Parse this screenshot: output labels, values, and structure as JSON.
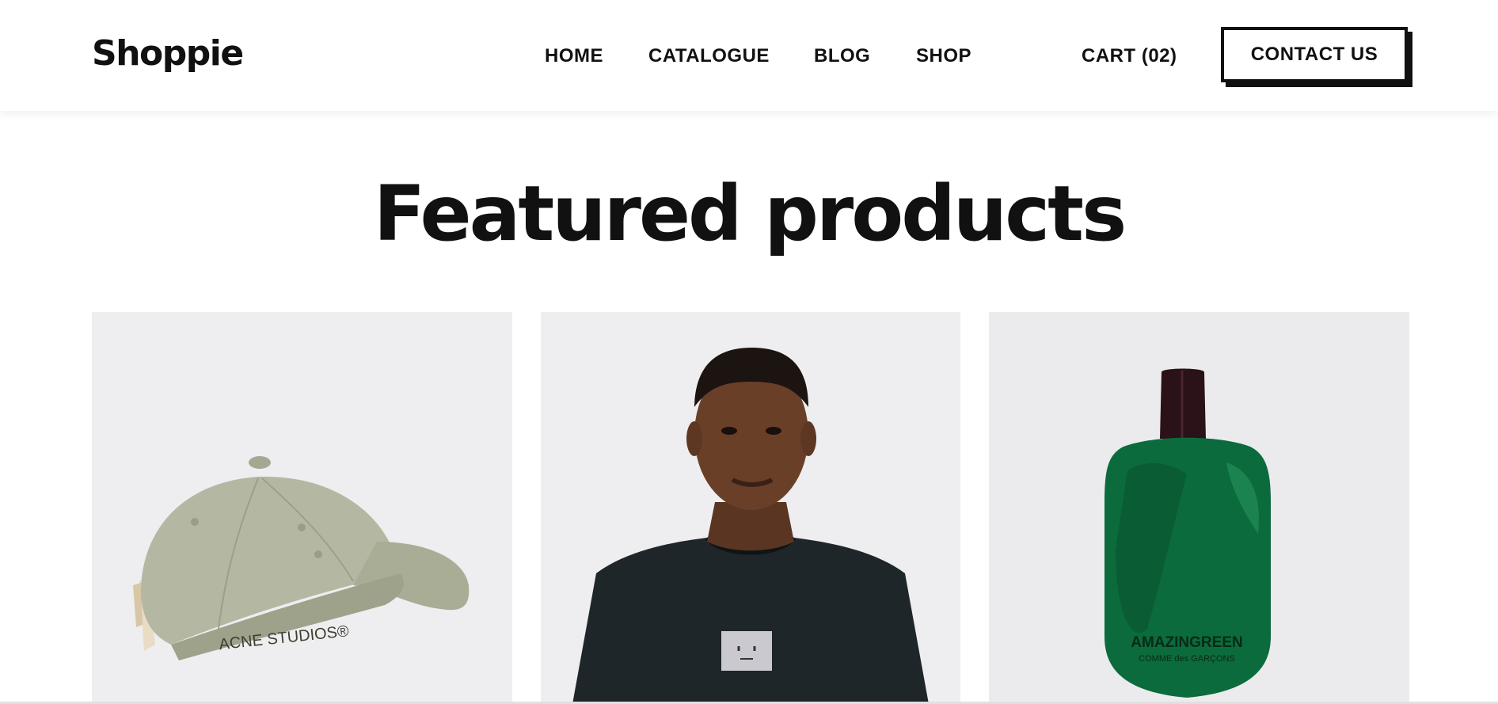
{
  "brand": {
    "logo": "Shoppie"
  },
  "nav": {
    "items": [
      {
        "label": "HOME"
      },
      {
        "label": "CATALOGUE"
      },
      {
        "label": "BLOG"
      },
      {
        "label": "SHOP"
      }
    ],
    "cart_label": "CART (02)",
    "contact_label": "CONTACT US"
  },
  "featured": {
    "title": "Featured products",
    "products": [
      {
        "image": "olive-cap-image",
        "print": "ACNE STUDIOS®"
      },
      {
        "image": "model-black-tshirt-image"
      },
      {
        "image": "green-perfume-bottle-image",
        "print_main": "AMAZINGREEN",
        "print_sub": "COMME des GARÇONS"
      }
    ]
  },
  "colors": {
    "text": "#111111",
    "card_bg": "#eeeef0",
    "cap": "#b4b8a2",
    "bottle": "#0c6b3c",
    "tshirt": "#1f262a"
  }
}
